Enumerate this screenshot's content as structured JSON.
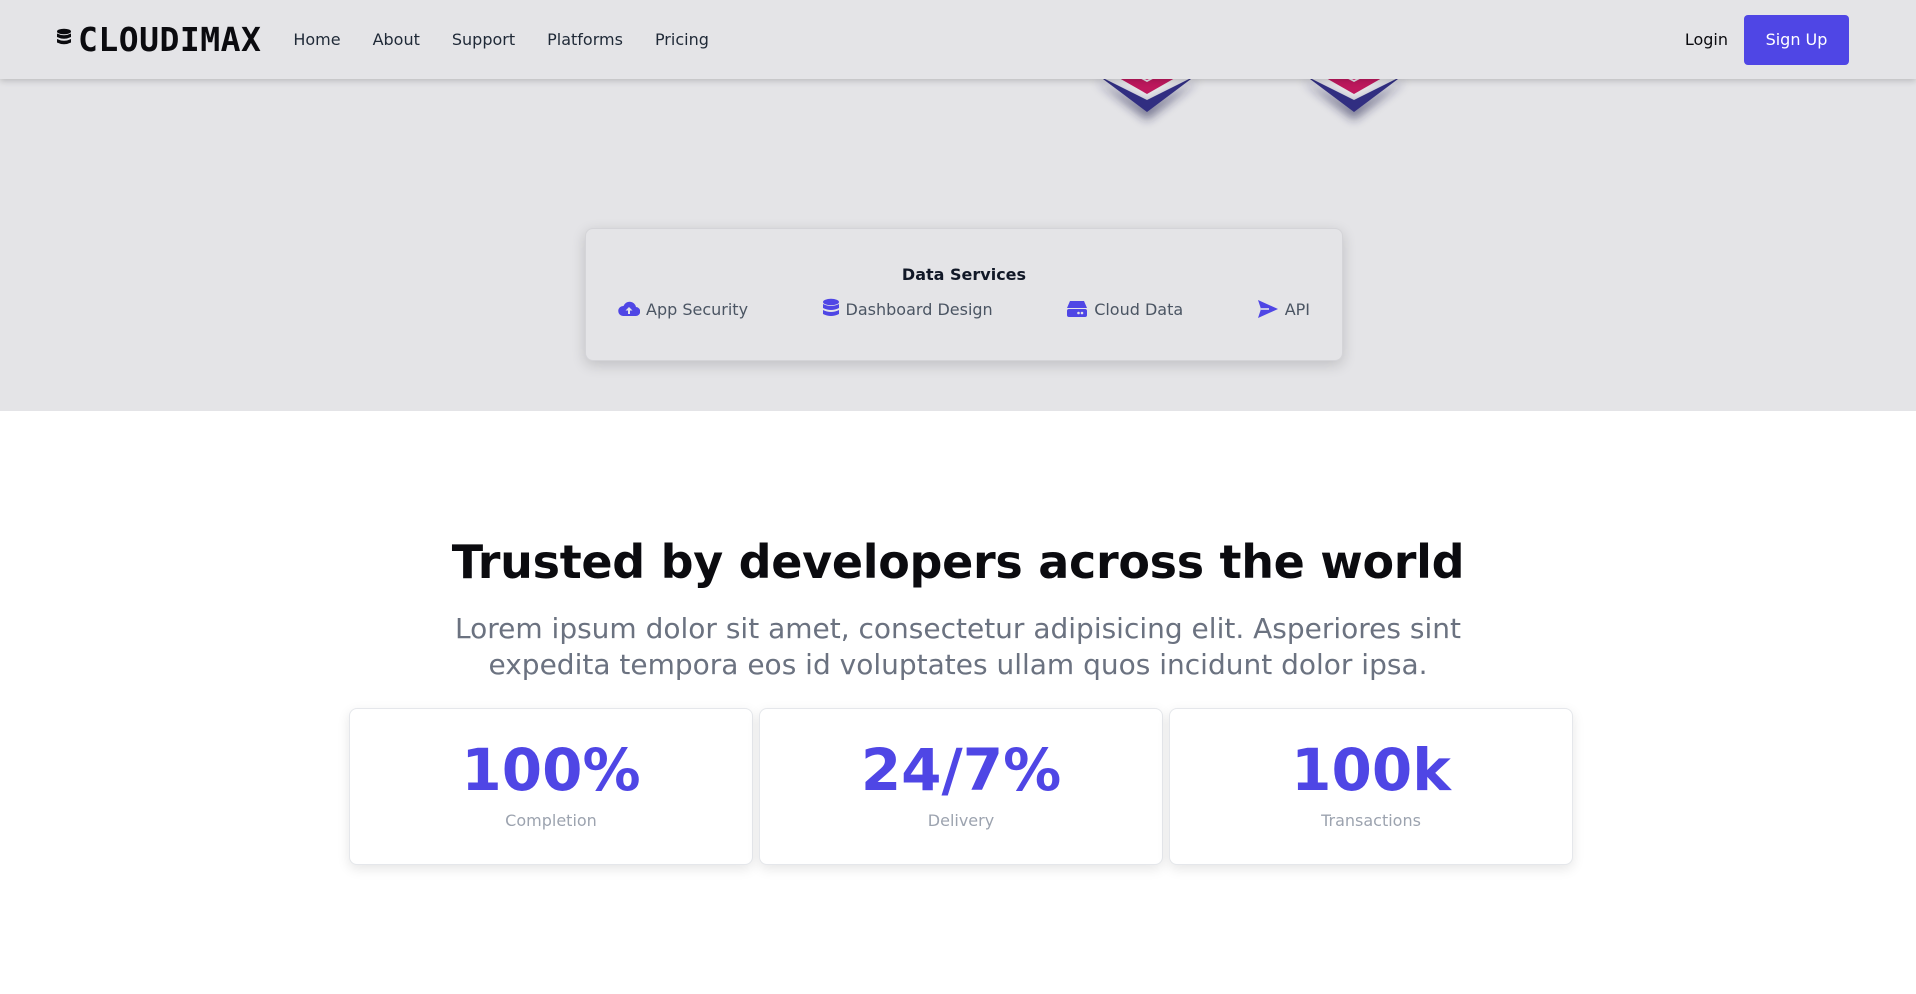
{
  "brand": {
    "name": "CLOUDIMAX",
    "icon": "database-icon",
    "accent": "#4f46e5"
  },
  "nav": {
    "links": [
      {
        "label": "Home"
      },
      {
        "label": "About"
      },
      {
        "label": "Support"
      },
      {
        "label": "Platforms"
      },
      {
        "label": "Pricing"
      }
    ],
    "login_label": "Login",
    "signup_label": "Sign Up"
  },
  "services": {
    "title": "Data Services",
    "items": [
      {
        "label": "App Security",
        "icon": "cloud-upload-icon"
      },
      {
        "label": "Dashboard Design",
        "icon": "database-icon"
      },
      {
        "label": "Cloud Data",
        "icon": "server-icon"
      },
      {
        "label": "API",
        "icon": "paper-plane-icon"
      }
    ]
  },
  "trust": {
    "headline": "Trusted by developers across the world",
    "subtext": "Lorem ipsum dolor sit amet, consectetur adipisicing elit. Asperiores sint expedita tempora eos id voluptates ullam quos incidunt dolor ipsa."
  },
  "stats": [
    {
      "value": "100%",
      "label": "Completion"
    },
    {
      "value": "24/7%",
      "label": "Delivery"
    },
    {
      "value": "100k",
      "label": "Transactions"
    }
  ]
}
